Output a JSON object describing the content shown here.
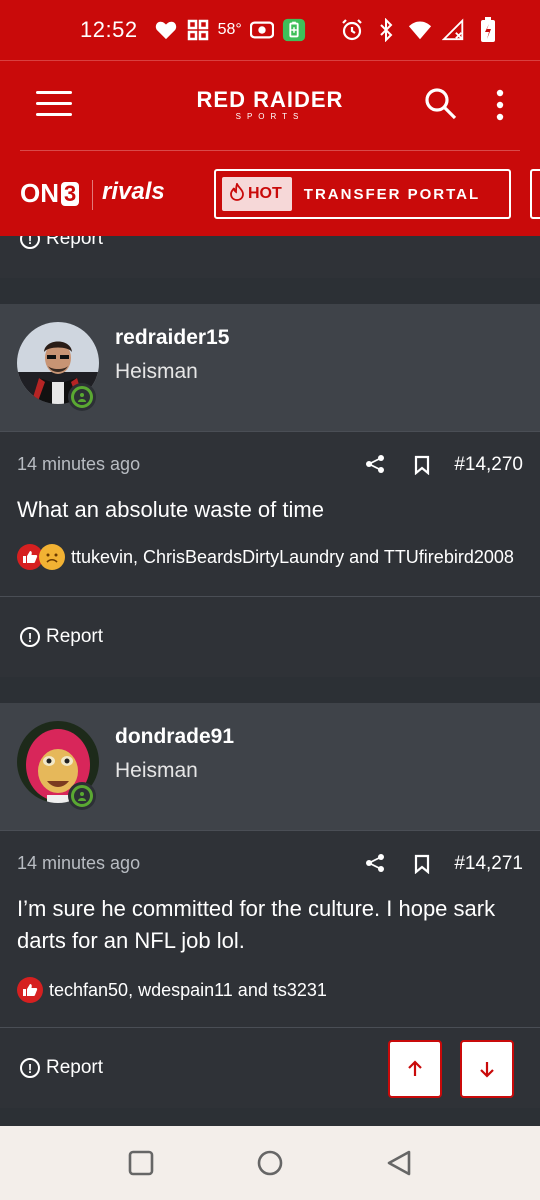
{
  "status_bar": {
    "time": "12:52",
    "temperature": "58°",
    "icons": [
      "heart-icon",
      "apps-icon",
      "radio-icon",
      "battery-saver-icon",
      "alarm-icon",
      "bluetooth-icon",
      "wifi-icon",
      "signal-icon",
      "battery-icon"
    ]
  },
  "header": {
    "brand_main": "RED RAIDER",
    "brand_sub": "SPORTS",
    "on3_label": "ON",
    "on3_digit": "3",
    "rivals_label": "rivals",
    "hot_label": "HOT",
    "portal_label": "TRANSFER PORTAL"
  },
  "top_partial": {
    "report_label": "Report"
  },
  "posts": [
    {
      "username": "redraider15",
      "rank": "Heisman",
      "time": "14 minutes ago",
      "post_number": "#14,270",
      "message": "What an absolute waste of time",
      "reaction_names": "ttukevin, ChrisBeardsDirtyLaundry and TTUfirebird2008",
      "reactions": [
        "like",
        "sad"
      ],
      "report_label": "Report"
    },
    {
      "username": "dondrade91",
      "rank": "Heisman",
      "time": "14 minutes ago",
      "post_number": "#14,271",
      "message": "I’m sure he committed for the culture. I hope sark darts for an NFL job lol.",
      "reaction_names": "techfan50, wdespain11 and ts3231",
      "reactions": [
        "like"
      ],
      "report_label": "Report"
    }
  ],
  "colors": {
    "brand_red": "#c90a0a",
    "card": "#3f4349",
    "body": "#2f3237",
    "online_green": "#5aa832"
  }
}
